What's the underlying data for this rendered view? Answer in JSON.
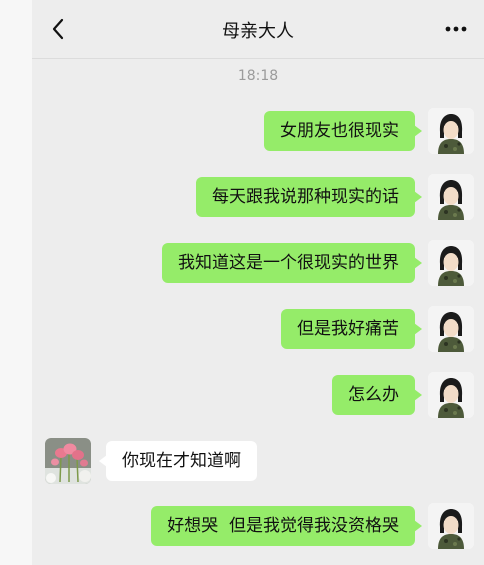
{
  "header": {
    "title": "母亲大人",
    "back_icon": "chevron-left-icon",
    "more_icon": "more-dots-icon"
  },
  "timestamp": "18:18",
  "messages": [
    {
      "side": "me",
      "text": "女朋友也很现实"
    },
    {
      "side": "me",
      "text": "每天跟我说那种现实的话"
    },
    {
      "side": "me",
      "text": "我知道这是一个很现实的世界"
    },
    {
      "side": "me",
      "text": "但是我好痛苦"
    },
    {
      "side": "me",
      "text": "怎么办"
    },
    {
      "side": "other",
      "text": "你现在才知道啊"
    },
    {
      "side": "me",
      "text": "好想哭  但是我觉得我没资格哭"
    }
  ],
  "colors": {
    "my_bubble": "#95ec69",
    "other_bubble": "#ffffff",
    "chat_background": "#ededed"
  }
}
